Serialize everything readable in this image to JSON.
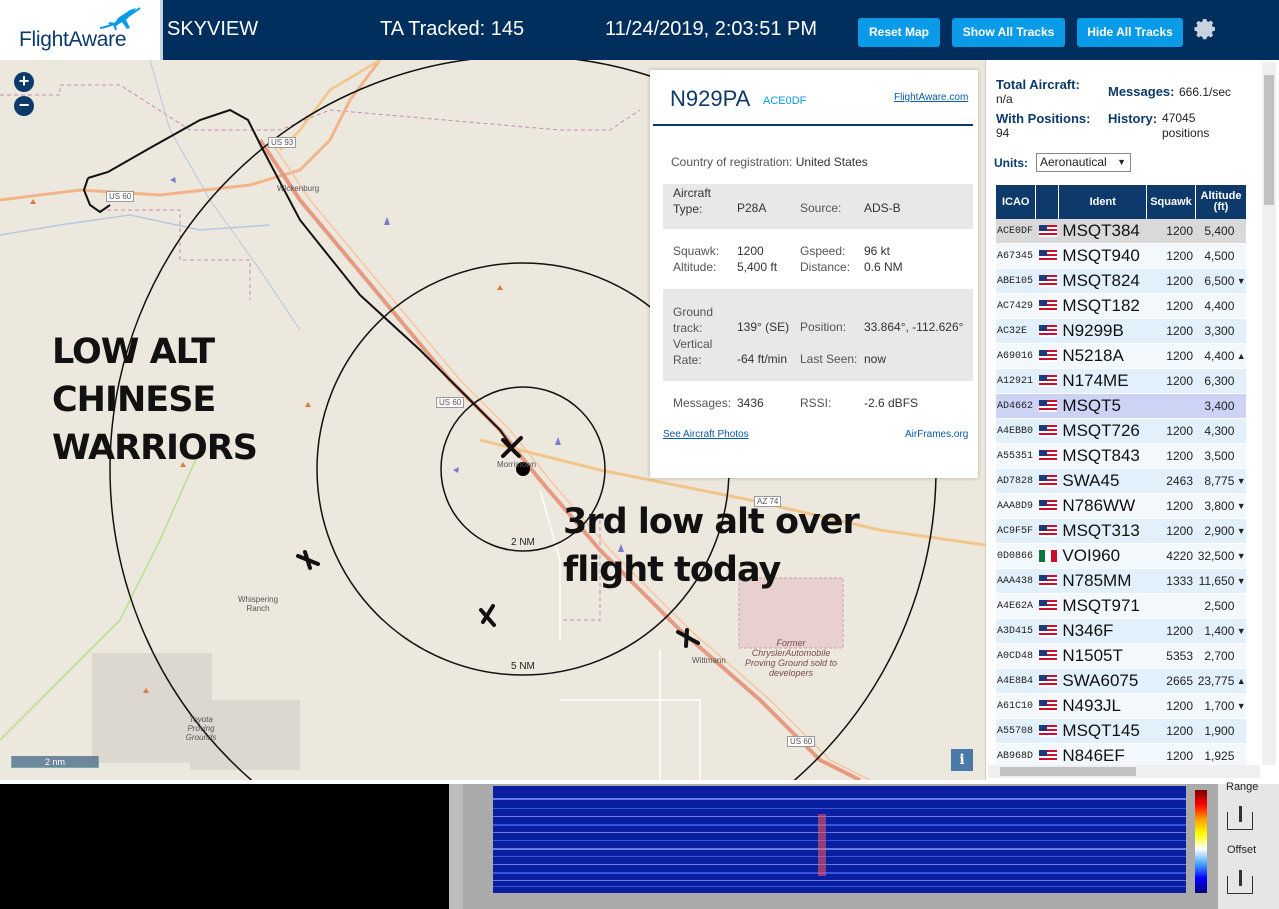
{
  "header": {
    "logo_text": "FlightAware",
    "app_name": "SKYVIEW",
    "tracked": "TA Tracked: 145",
    "datetime": "11/24/2019, 2:03:51 PM",
    "buttons": {
      "reset": "Reset Map",
      "show": "Show All Tracks",
      "hide": "Hide All Tracks"
    },
    "colors": {
      "bar": "#002f5d",
      "button": "#0a9be8"
    }
  },
  "map": {
    "zoom_in": "+",
    "zoom_out": "−",
    "overlay_1": "LOW ALT CHINESE WARRIORS",
    "overlay_2": "3rd low alt over flight today",
    "range_inner": "2 NM",
    "range_outer": "5 NM",
    "scale": "2 nm",
    "info": "i",
    "places": {
      "wickenburg": "Wickenburg",
      "morristown": "Morristown",
      "wittmann": "Wittmann",
      "whispering_ranch": "Whispering Ranch",
      "proving_grounds": "Toyota Proving Grounds",
      "former": "Former ChryslerAutomobile Proving Ground sold to developers"
    },
    "roads": {
      "us60_a": "US 60",
      "us60_b": "US 60",
      "us60_c": "US 60",
      "us93": "US 93",
      "az74": "AZ 74"
    }
  },
  "popup": {
    "registration": "N929PA",
    "hex": "ACE0DF",
    "link_fa": "FlightAware.com",
    "country_label": "Country of registration:",
    "country": "United States",
    "aircraft_type_label": "Aircraft Type:",
    "aircraft_type": "P28A",
    "source_label": "Source:",
    "source": "ADS-B",
    "squawk_label": "Squawk:",
    "squawk": "1200",
    "gspeed_label": "Gspeed:",
    "gspeed": "96 kt",
    "altitude_label": "Altitude:",
    "altitude": "5,400 ft",
    "distance_label": "Distance:",
    "distance": "0.6 NM",
    "ground_track_label": "Ground track:",
    "ground_track": "139° (SE)",
    "position_label": "Position:",
    "position": "33.864°, -112.626°",
    "vrate_label": "Vertical Rate:",
    "vrate": "-64 ft/min",
    "last_seen_label": "Last Seen:",
    "last_seen": "now",
    "messages_label": "Messages:",
    "messages": "3436",
    "rssi_label": "RSSI:",
    "rssi": "-2.6 dBFS",
    "link_photos": "See Aircraft Photos",
    "link_airframes": "AirFrames.org"
  },
  "panel": {
    "total_label": "Total Aircraft:",
    "total": "n/a",
    "messages_label": "Messages:",
    "messages": "666.1/sec",
    "with_pos_label": "With Positions:",
    "with_pos": "94",
    "history_label": "History:",
    "history": "47045 positions",
    "units_label": "Units:",
    "units": "Aeronautical",
    "columns": [
      "ICAO",
      "Ident",
      "Squawk",
      "Altitude (ft)"
    ],
    "rows": [
      {
        "icao": "ACE0DF",
        "flag": "us",
        "ident": "MSQT384",
        "squawk": "1200",
        "alt": "5,400",
        "trend": "",
        "style": "sel"
      },
      {
        "icao": "A67345",
        "flag": "us",
        "ident": "MSQT940",
        "squawk": "1200",
        "alt": "4,500",
        "trend": "",
        "style": "alt"
      },
      {
        "icao": "ABE105",
        "flag": "us",
        "ident": "MSQT824",
        "squawk": "1200",
        "alt": "6,500",
        "trend": "▼",
        "style": ""
      },
      {
        "icao": "AC7429",
        "flag": "us",
        "ident": "MSQT182",
        "squawk": "1200",
        "alt": "4,400",
        "trend": "",
        "style": "alt"
      },
      {
        "icao": "AC32E",
        "flag": "us",
        "ident": "N9299B",
        "squawk": "1200",
        "alt": "3,300",
        "trend": "",
        "style": ""
      },
      {
        "icao": "A69016",
        "flag": "us",
        "ident": "N5218A",
        "squawk": "1200",
        "alt": "4,400",
        "trend": "▲",
        "style": "alt"
      },
      {
        "icao": "A12921",
        "flag": "us",
        "ident": "N174ME",
        "squawk": "1200",
        "alt": "6,300",
        "trend": "",
        "style": ""
      },
      {
        "icao": "AD4662",
        "flag": "us",
        "ident": "MSQT5",
        "squawk": "",
        "alt": "3,400",
        "trend": "",
        "style": "hl"
      },
      {
        "icao": "A4EBB0",
        "flag": "us",
        "ident": "MSQT726",
        "squawk": "1200",
        "alt": "4,300",
        "trend": "",
        "style": ""
      },
      {
        "icao": "A55351",
        "flag": "us",
        "ident": "MSQT843",
        "squawk": "1200",
        "alt": "3,500",
        "trend": "",
        "style": "alt"
      },
      {
        "icao": "AD7828",
        "flag": "us",
        "ident": "SWA45",
        "squawk": "2463",
        "alt": "8,775",
        "trend": "▼",
        "style": ""
      },
      {
        "icao": "AAA8D9",
        "flag": "us",
        "ident": "N786WW",
        "squawk": "1200",
        "alt": "3,800",
        "trend": "▼",
        "style": "alt"
      },
      {
        "icao": "AC9F5F",
        "flag": "us",
        "ident": "MSQT313",
        "squawk": "1200",
        "alt": "2,900",
        "trend": "▼",
        "style": ""
      },
      {
        "icao": "0D0866",
        "flag": "mx",
        "ident": "VOI960",
        "squawk": "4220",
        "alt": "32,500",
        "trend": "▼",
        "style": "alt"
      },
      {
        "icao": "AAA438",
        "flag": "us",
        "ident": "N785MM",
        "squawk": "1333",
        "alt": "11,650",
        "trend": "▼",
        "style": ""
      },
      {
        "icao": "A4E62A",
        "flag": "us",
        "ident": "MSQT971",
        "squawk": "",
        "alt": "2,500",
        "trend": "",
        "style": "alt"
      },
      {
        "icao": "A3D415",
        "flag": "us",
        "ident": "N346F",
        "squawk": "1200",
        "alt": "1,400",
        "trend": "▼",
        "style": ""
      },
      {
        "icao": "A0CD48",
        "flag": "us",
        "ident": "N1505T",
        "squawk": "5353",
        "alt": "2,700",
        "trend": "",
        "style": "alt"
      },
      {
        "icao": "A4E8B4",
        "flag": "us",
        "ident": "SWA6075",
        "squawk": "2665",
        "alt": "23,775",
        "trend": "▲",
        "style": ""
      },
      {
        "icao": "A61C10",
        "flag": "us",
        "ident": "N493JL",
        "squawk": "1200",
        "alt": "1,700",
        "trend": "▼",
        "style": "alt"
      },
      {
        "icao": "A55708",
        "flag": "us",
        "ident": "MSQT145",
        "squawk": "1200",
        "alt": "1,900",
        "trend": "",
        "style": ""
      },
      {
        "icao": "AB968D",
        "flag": "us",
        "ident": "N846EF",
        "squawk": "1200",
        "alt": "1,925",
        "trend": "",
        "style": "alt"
      }
    ]
  },
  "spectrum": {
    "range_label": "Range",
    "offset_label": "Offset"
  }
}
